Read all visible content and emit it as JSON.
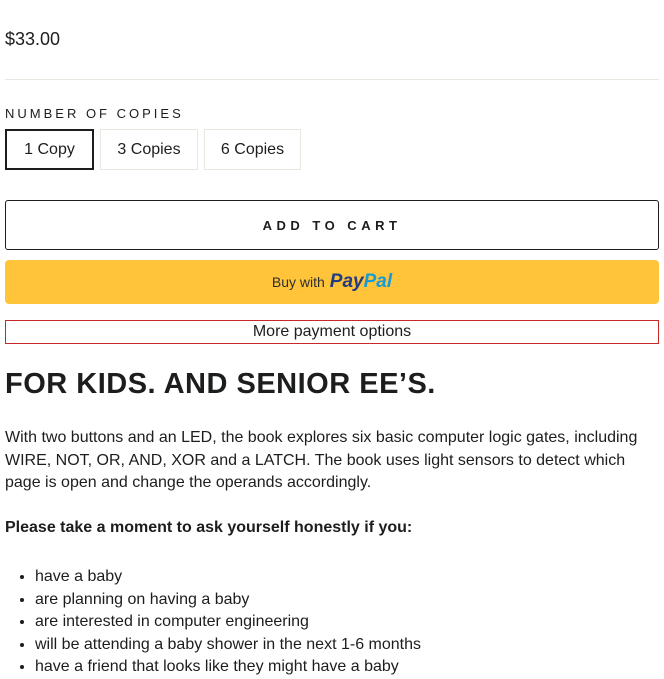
{
  "product": {
    "price": "$33.00",
    "variant_label": "NUMBER OF COPIES",
    "options": [
      "1 Copy",
      "3 Copies",
      "6 Copies"
    ],
    "selected_option": "1 Copy",
    "add_to_cart": "ADD TO CART",
    "paypal_buy_with": "Buy with",
    "paypal_logo_pay": "Pay",
    "paypal_logo_pal": "Pal",
    "more_payment": "More payment options"
  },
  "description": {
    "heading": "FOR KIDS. AND SENIOR EE’S.",
    "paragraph": "With two buttons and an LED, the book explores six basic computer logic gates, including WIRE, NOT, OR, AND, XOR and a LATCH. The book uses light sensors to detect which page is open and change the operands accordingly.",
    "ask": "Please take a moment to ask yourself honestly if you:",
    "list": [
      "have a baby",
      "are planning on having a baby",
      "are interested in computer engineering",
      "will be attending a baby shower in the next 1-6 months",
      "have a friend that looks like they might have a baby"
    ]
  },
  "colors": {
    "paypal_yellow": "#ffc439",
    "paypal_dark_blue": "#253b80",
    "paypal_light_blue": "#179bd7",
    "outline_red": "#c62828"
  }
}
